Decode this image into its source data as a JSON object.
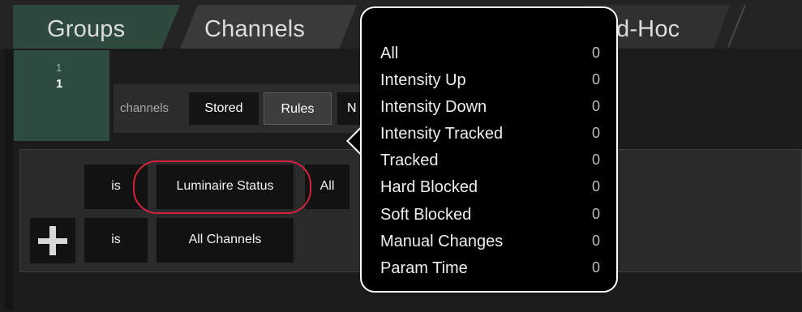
{
  "tabs": {
    "groups": "Groups",
    "channels": "Channels",
    "adhoc": "d-Hoc"
  },
  "group_list": {
    "dim_number": "1",
    "number": "1"
  },
  "toolbar": {
    "label": "channels",
    "stored": "Stored",
    "rules": "Rules",
    "next_partial": "N"
  },
  "rules": {
    "row1": {
      "operator": "is",
      "attribute": "Luminaire Status",
      "value_partial": "All"
    },
    "row2": {
      "operator": "is",
      "attribute": "All Channels"
    }
  },
  "popover": {
    "items": [
      {
        "label": "All",
        "count": "0"
      },
      {
        "label": "Intensity Up",
        "count": "0"
      },
      {
        "label": "Intensity Down",
        "count": "0"
      },
      {
        "label": "Intensity Tracked",
        "count": "0"
      },
      {
        "label": "Tracked",
        "count": "0"
      },
      {
        "label": "Hard Blocked",
        "count": "0"
      },
      {
        "label": "Soft Blocked",
        "count": "0"
      },
      {
        "label": "Manual Changes",
        "count": "0"
      },
      {
        "label": "Param Time",
        "count": "0"
      }
    ]
  },
  "colors": {
    "active_tab": "#2e4a3d",
    "highlight_circle": "#d4213d",
    "popover_bg": "#000000"
  },
  "icons": {
    "add_rule": "plus-icon"
  }
}
